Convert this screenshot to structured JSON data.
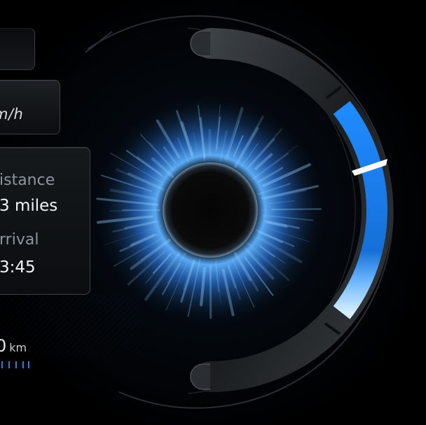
{
  "speed_panel": {
    "unit_partial": "m/h"
  },
  "trip_panel": {
    "distance_label_partial": "istance",
    "distance_value_partial": "3 miles",
    "arrival_label_partial": "rrival",
    "arrival_value_partial": "3:45"
  },
  "odometer": {
    "value_partial": "0",
    "unit": "km"
  },
  "gauge": {
    "fill_fraction": 0.75,
    "accent_color": "#1a82f0",
    "highlight_color": "#bfe4ff",
    "needle_color": "#ffffff"
  },
  "icons": {
    "center_orb": "blue-burst-orb-icon"
  }
}
